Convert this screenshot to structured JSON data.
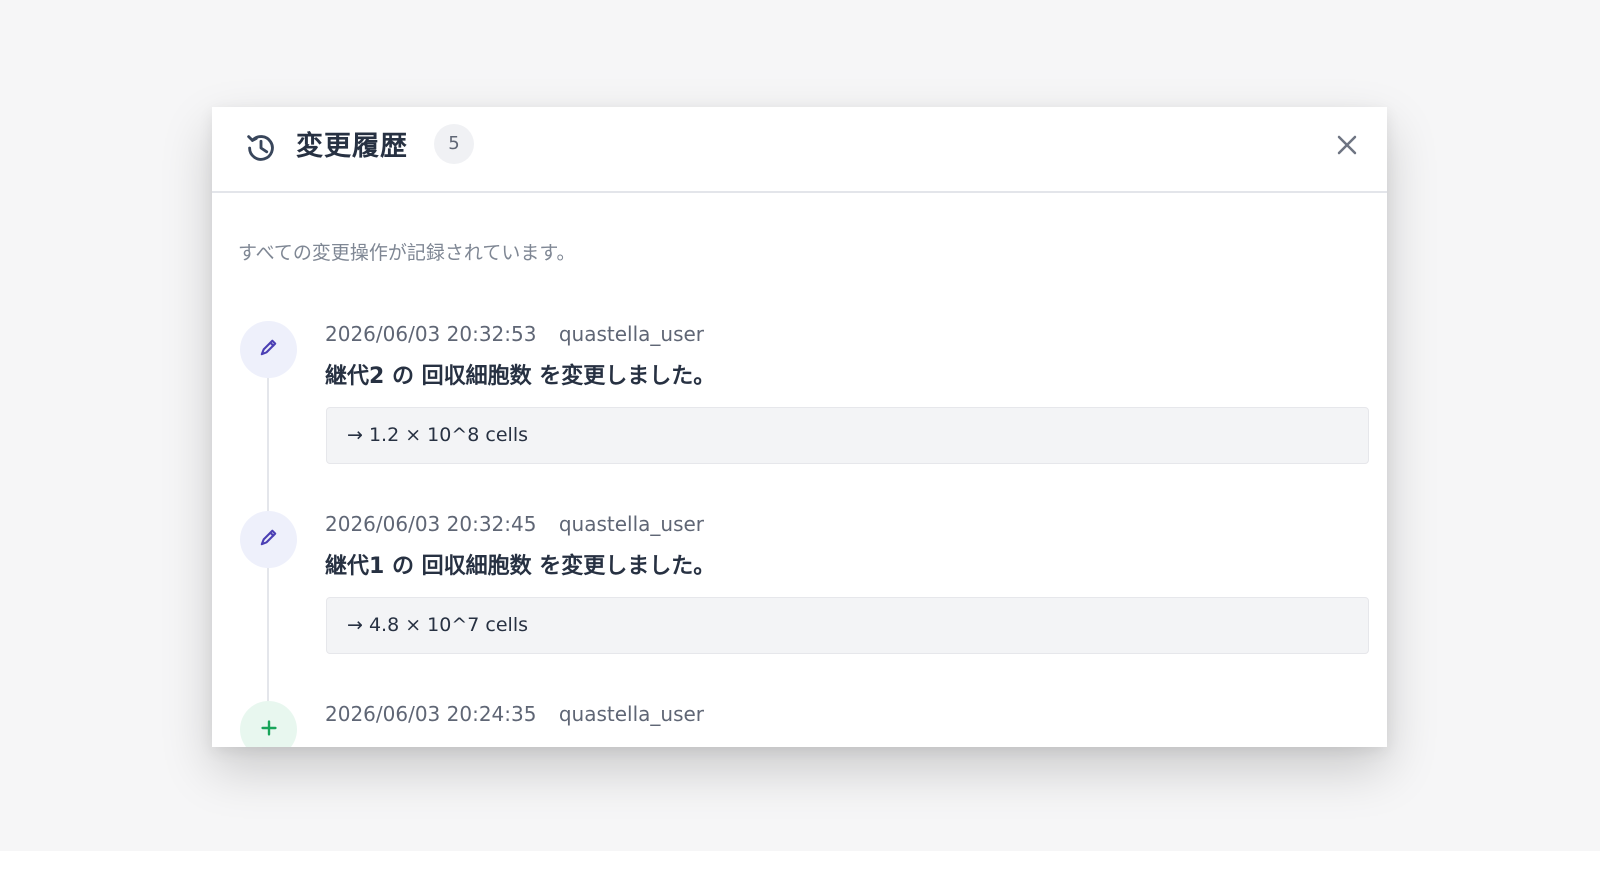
{
  "modal": {
    "title": "変更履歴",
    "count": "5",
    "description": "すべての変更操作が記録されています。",
    "close_icon": "close-icon",
    "header_icon": "history-icon"
  },
  "entries": [
    {
      "icon": "pencil-icon",
      "timestamp": "2026/06/03 20:32:53",
      "user": "quastella_user",
      "message": "継代2 の 回収細胞数 を変更しました。",
      "change": "→ 1.2 × 10^8 cells"
    },
    {
      "icon": "pencil-icon",
      "timestamp": "2026/06/03 20:32:45",
      "user": "quastella_user",
      "message": "継代1 の 回収細胞数 を変更しました。",
      "change": "→ 4.8 × 10^7 cells"
    },
    {
      "icon": "plus-icon",
      "timestamp": "2026/06/03 20:24:35",
      "user": "quastella_user"
    }
  ],
  "colors": {
    "accent": "#4b3fb4",
    "edit_icon_bg": "#eef0fb",
    "add_icon": "#18a55a",
    "add_icon_bg": "#e8f7ef"
  }
}
